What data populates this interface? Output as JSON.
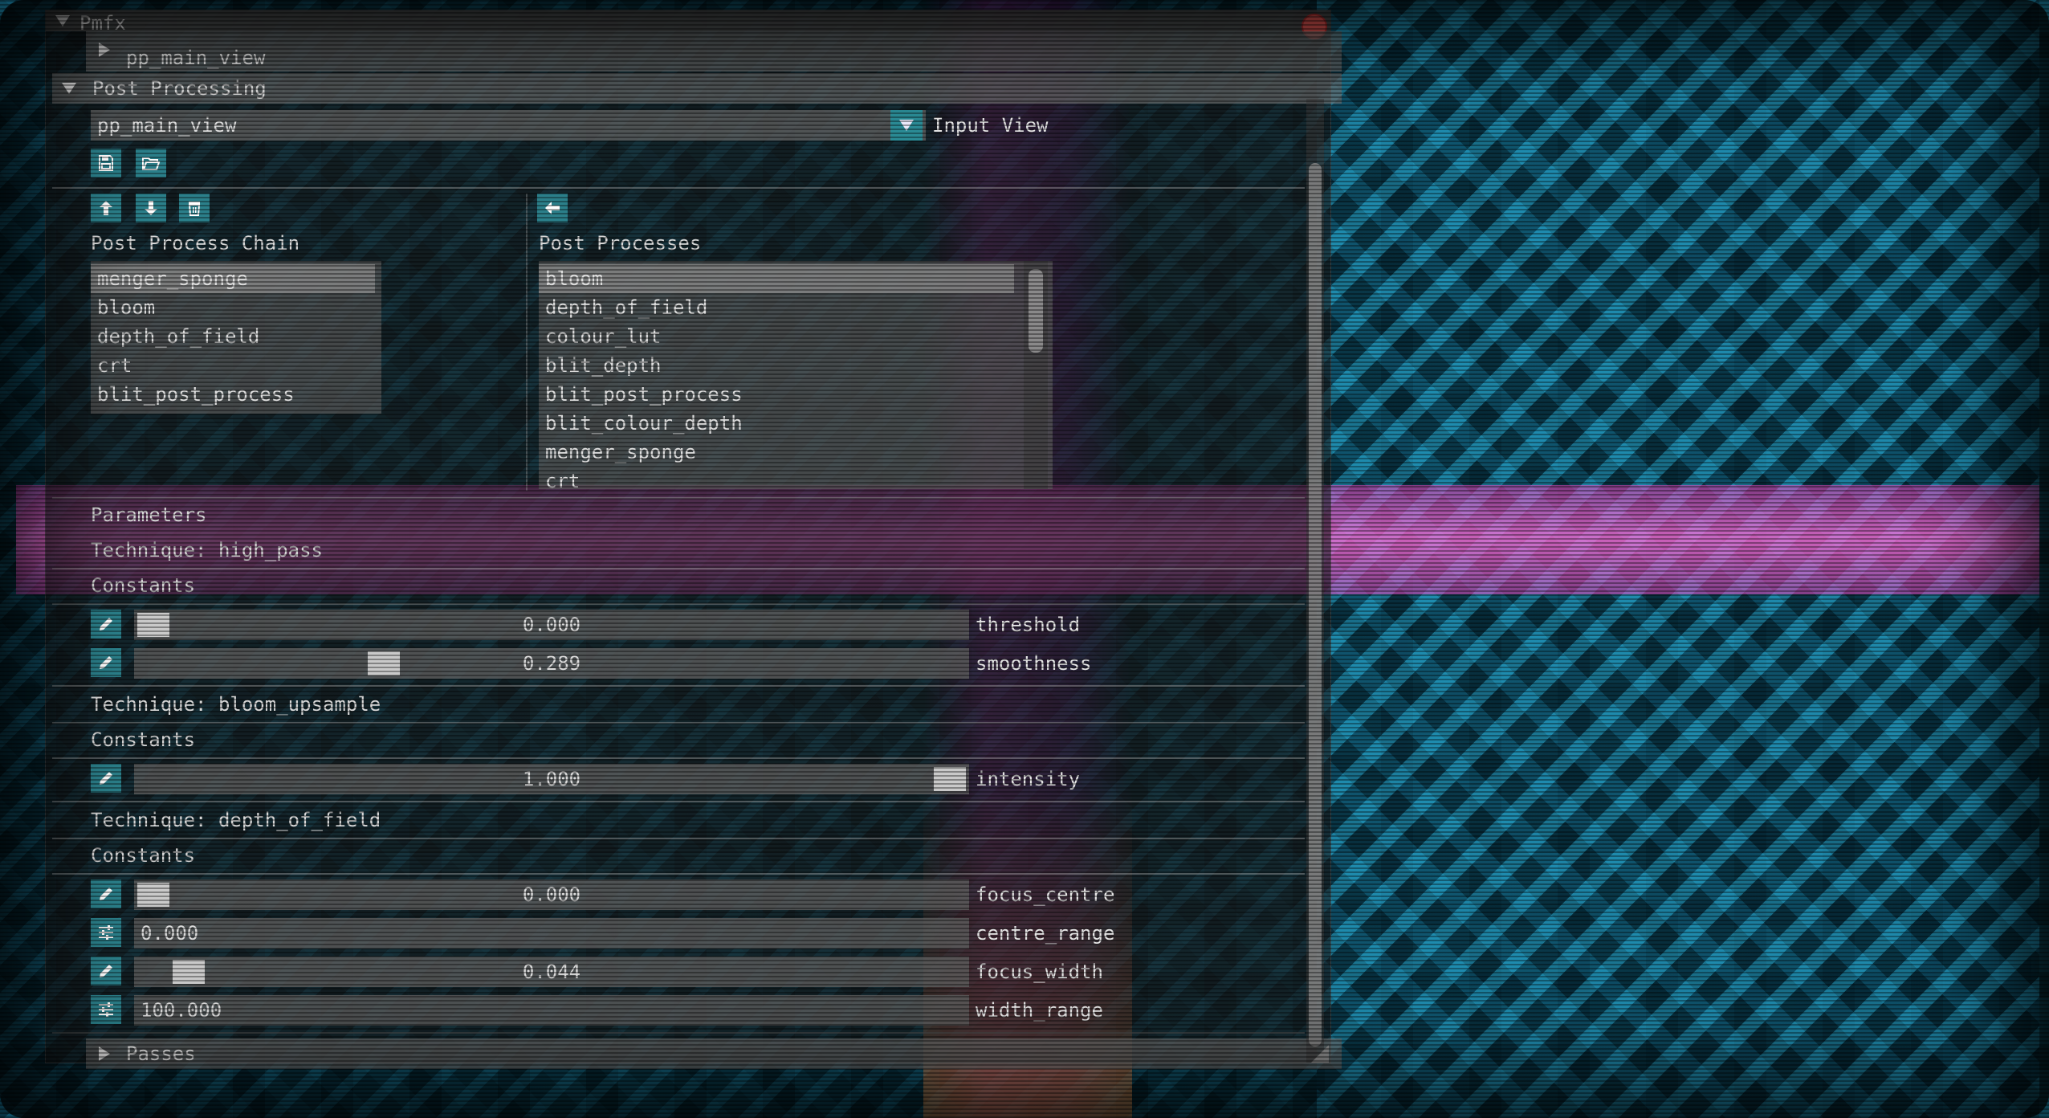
{
  "window": {
    "title": "Pmfx",
    "collapsed_header": "pp_main_view"
  },
  "post_processing": {
    "header": "Post Processing",
    "input_view": {
      "selected": "pp_main_view",
      "label": "Input View"
    },
    "icons": {
      "save": "save-icon",
      "open": "folder-open-icon",
      "up": "arrow-up-icon",
      "down": "arrow-down-icon",
      "delete": "trash-icon",
      "add": "arrow-left-icon"
    },
    "chain": {
      "label": "Post Process Chain",
      "items": [
        "menger_sponge",
        "bloom",
        "depth_of_field",
        "crt",
        "blit_post_process"
      ],
      "selected_index": 0
    },
    "processes": {
      "label": "Post Processes",
      "items": [
        "bloom",
        "depth_of_field",
        "colour_lut",
        "blit_depth",
        "blit_post_process",
        "blit_colour_depth",
        "menger_sponge",
        "crt"
      ],
      "selected_index": 0
    }
  },
  "parameters": {
    "heading": "Parameters",
    "techniques": [
      {
        "title": "Technique: high_pass",
        "constants_label": "Constants",
        "controls": [
          {
            "type": "slider",
            "value": "0.000",
            "label": "threshold",
            "fraction": 0.0
          },
          {
            "type": "slider",
            "value": "0.289",
            "label": "smoothness",
            "fraction": 0.289
          }
        ]
      },
      {
        "title": "Technique: bloom_upsample",
        "constants_label": "Constants",
        "controls": [
          {
            "type": "slider",
            "value": "1.000",
            "label": "intensity",
            "fraction": 1.0
          }
        ]
      },
      {
        "title": "Technique: depth_of_field",
        "constants_label": "Constants",
        "controls": [
          {
            "type": "slider",
            "value": "0.000",
            "label": "focus_centre",
            "fraction": 0.0
          },
          {
            "type": "input",
            "value": "0.000",
            "label": "centre_range"
          },
          {
            "type": "slider",
            "value": "0.044",
            "label": "focus_width",
            "fraction": 0.044
          },
          {
            "type": "input",
            "value": "100.000",
            "label": "width_range"
          }
        ]
      }
    ]
  },
  "passes": {
    "header": "Passes"
  },
  "colors": {
    "accent": "#2b8c96",
    "close": "#d9534f",
    "pink_band": "#ff6edc"
  }
}
